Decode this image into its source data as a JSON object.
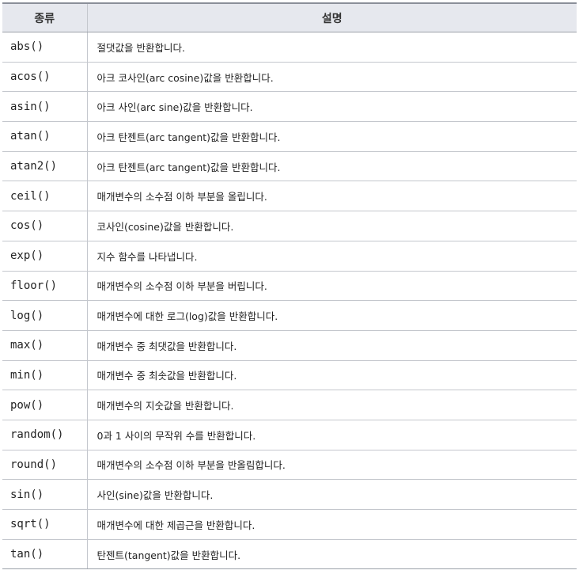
{
  "table": {
    "headers": [
      "종류",
      "설명"
    ],
    "rows": [
      {
        "name": "abs()",
        "desc": "절댓값을 반환합니다."
      },
      {
        "name": "acos()",
        "desc": "아크 코사인(arc cosine)값을 반환합니다."
      },
      {
        "name": "asin()",
        "desc": "아크 사인(arc sine)값을 반환합니다."
      },
      {
        "name": "atan()",
        "desc": "아크 탄젠트(arc tangent)값을 반환합니다."
      },
      {
        "name": "atan2()",
        "desc": "아크 탄젠트(arc tangent)값을 반환합니다."
      },
      {
        "name": "ceil()",
        "desc": "매개변수의 소수점 이하 부분을 올립니다."
      },
      {
        "name": "cos()",
        "desc": "코사인(cosine)값을 반환합니다."
      },
      {
        "name": "exp()",
        "desc": "지수 함수를 나타냅니다."
      },
      {
        "name": "floor()",
        "desc": "매개변수의 소수점 이하 부분을 버립니다."
      },
      {
        "name": "log()",
        "desc": "매개변수에 대한 로그(log)값을 반환합니다."
      },
      {
        "name": "max()",
        "desc": "매개변수 중 최댓값을 반환합니다."
      },
      {
        "name": "min()",
        "desc": "매개변수 중 최솟값을 반환합니다."
      },
      {
        "name": "pow()",
        "desc": "매개변수의 지숫값을 반환합니다."
      },
      {
        "name": "random()",
        "desc": "0과 1 사이의 무작위 수를 반환합니다."
      },
      {
        "name": "round()",
        "desc": "매개변수의 소수점 이하 부분을 반올림합니다."
      },
      {
        "name": "sin()",
        "desc": "사인(sine)값을 반환합니다."
      },
      {
        "name": "sqrt()",
        "desc": "매개변수에 대한 제곱근을 반환합니다."
      },
      {
        "name": "tan()",
        "desc": "탄젠트(tangent)값을 반환합니다."
      }
    ]
  }
}
